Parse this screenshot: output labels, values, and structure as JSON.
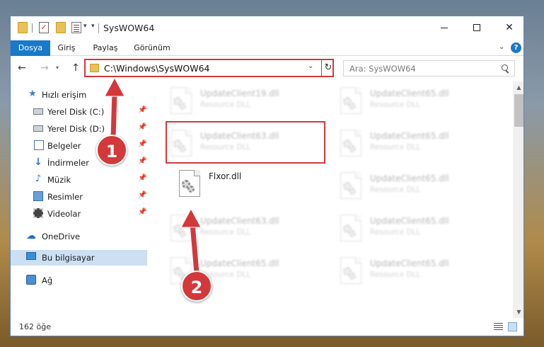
{
  "window": {
    "title": "SysWOW64",
    "min_label": "",
    "close_label": "✕"
  },
  "ribbon": {
    "tabs": [
      "Dosya",
      "Giriş",
      "Paylaş",
      "Görünüm"
    ],
    "help": "?"
  },
  "address": {
    "path": "C:\\Windows\\SysWOW64",
    "search_placeholder": "Ara: SysWOW64"
  },
  "sidebar": {
    "items": [
      {
        "label": "Hızlı erişim"
      },
      {
        "label": "Yerel Disk (C:)"
      },
      {
        "label": "Yerel Disk (D:)"
      },
      {
        "label": "Belgeler"
      },
      {
        "label": "İndirmeler"
      },
      {
        "label": "Müzik"
      },
      {
        "label": "Resimler"
      },
      {
        "label": "Videolar"
      },
      {
        "label": "OneDrive"
      },
      {
        "label": "Bu bilgisayar"
      },
      {
        "label": "Ağ"
      }
    ]
  },
  "files": [
    {
      "name": "UpdateClient19.dll",
      "desc": "Resource DLL"
    },
    {
      "name": "UpdateClient65.dll",
      "desc": "Resource DLL"
    },
    {
      "name": "UpdateClient63.dll",
      "desc": "Resource DLL"
    },
    {
      "name": "UpdateClient65.dll",
      "desc": "Resource DLL"
    },
    {
      "name": "Flxor.dll",
      "desc": ""
    },
    {
      "name": "UpdateClient65.dll",
      "desc": "Resource DLL"
    },
    {
      "name": "UpdateClient63.dll",
      "desc": "Resource DLL"
    },
    {
      "name": "UpdateClient65.dll",
      "desc": "Resource DLL"
    },
    {
      "name": "UpdateClient65.dll",
      "desc": "Resource DLL"
    },
    {
      "name": "UpdateClient65.dll",
      "desc": "Resource DLL"
    }
  ],
  "status": {
    "count": "162 öğe"
  },
  "annotations": {
    "step1": "1",
    "step2": "2",
    "color": "#d3383a"
  }
}
